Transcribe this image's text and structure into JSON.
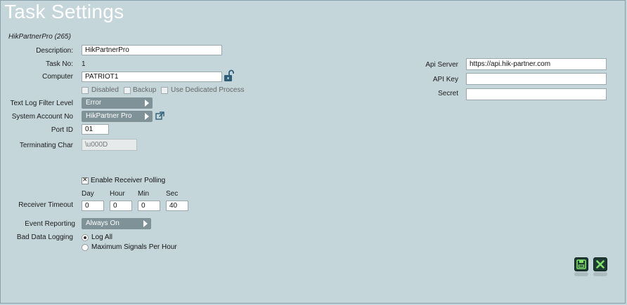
{
  "title": "Task Settings",
  "subtitle": "HikPartnerPro (265)",
  "fields": {
    "description_label": "Description:",
    "description_value": "HikPartnerPro",
    "task_no_label": "Task No:",
    "task_no_value": "1",
    "computer_label": "Computer",
    "computer_value": "PATRIOT1",
    "disabled_label": "Disabled",
    "backup_label": "Backup",
    "dedicated_label": "Use Dedicated Process",
    "text_log_label": "Text Log Filter Level",
    "text_log_value": "Error",
    "system_account_label": "System Account No",
    "system_account_value": "HikPartner Pro",
    "port_id_label": "Port ID",
    "port_id_value": "01",
    "terminating_label": "Terminating Char",
    "terminating_value": "\\u000D",
    "enable_polling_label": "Enable Receiver Polling",
    "day_label": "Day",
    "hour_label": "Hour",
    "min_label": "Min",
    "sec_label": "Sec",
    "receiver_timeout_label": "Receiver Timeout",
    "day_value": "0",
    "hour_value": "0",
    "min_value": "0",
    "sec_value": "40",
    "event_reporting_label": "Event Reporting",
    "event_reporting_value": "Always On",
    "bad_data_label": "Bad Data Logging",
    "log_all_label": "Log All",
    "max_signals_label": "Maximum Signals Per Hour"
  },
  "right": {
    "api_server_label": "Api Server",
    "api_server_value": "https://api.hik-partner.com",
    "api_key_label": "API Key",
    "api_key_value": "",
    "secret_label": "Secret",
    "secret_value": ""
  },
  "state": {
    "disabled": false,
    "backup": false,
    "dedicated": false,
    "enable_polling": true,
    "bad_data_logging": "Log All"
  },
  "icons": {
    "computer_action": "open-lock-icon",
    "account_link": "external-link-icon",
    "save": "save-icon",
    "cancel": "close-icon"
  },
  "colors": {
    "background": "#c5d6db",
    "dropdown": "#7e9297",
    "action_button": "#1e3a33",
    "action_icon": "#7fe06a"
  }
}
